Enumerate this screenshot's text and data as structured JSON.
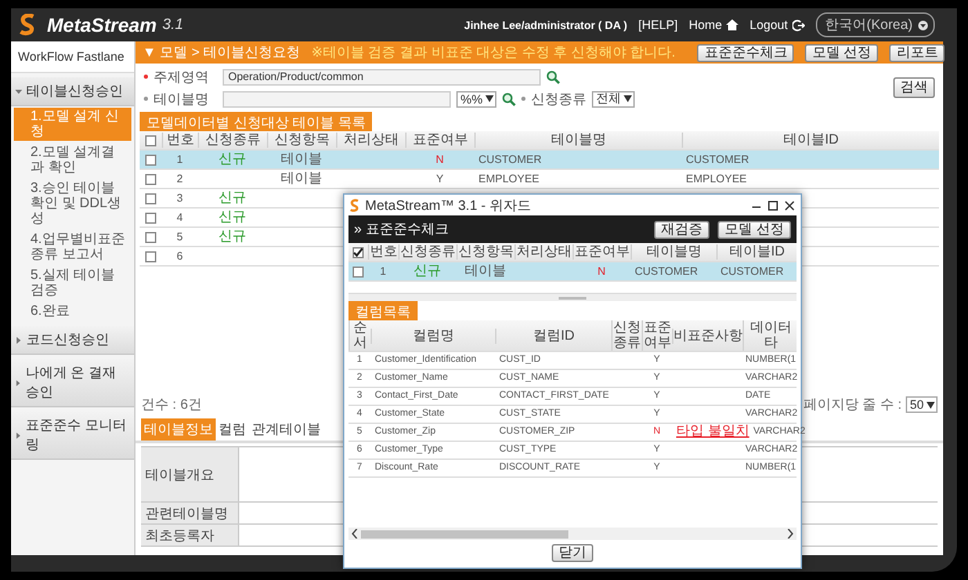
{
  "app": {
    "name": "MetaStream",
    "version": "3.1"
  },
  "header": {
    "user": "Jinhee Lee/administrator ( DA )",
    "help": "[HELP]",
    "home": "Home",
    "logout": "Logout",
    "language": "한국어(Korea)"
  },
  "sidebar": {
    "title": "WorkFlow Fastlane",
    "sections": [
      {
        "label": "테이블신청승인",
        "expanded": true,
        "items": [
          {
            "label": "1.모델 설계 신청",
            "selected": true
          },
          {
            "label": "2.모델 설계결과 확인",
            "selected": false
          },
          {
            "label": "3.승인 테이블 확인 및 DDL생성",
            "selected": false
          },
          {
            "label": "4.업무별비표준 종류 보고서",
            "selected": false
          },
          {
            "label": "5.실제 테이블 검증",
            "selected": false
          },
          {
            "label": "6.완료",
            "selected": false
          }
        ]
      },
      {
        "label": "코드신청승인",
        "expanded": false
      },
      {
        "label": "나에게 온 결재 승인",
        "expanded": false
      },
      {
        "label": "표준준수 모니터링",
        "expanded": false
      }
    ]
  },
  "page": {
    "breadcrumb": "▼ 모델 > 테이블신청요청",
    "notice": "※테이블 검증 결과 비표준 대상은 수정 후 신청해야 합니다.",
    "buttons": [
      "표준준수체크",
      "모델 선정",
      "리포트"
    ]
  },
  "search": {
    "subject_area": {
      "label": "주제영역",
      "value": "Operation/Product/common"
    },
    "table_name": {
      "label": "테이블명",
      "match": "%%"
    },
    "request_type": {
      "label": "신청종류",
      "value": "전체"
    },
    "button": "검색"
  },
  "list": {
    "title": "모델데이터별 신청대상 테이블 목록",
    "all_checked": false,
    "columns": [
      "번호",
      "신청종류",
      "신청항목",
      "처리상태",
      "표준여부",
      "테이블명",
      "테이블ID"
    ],
    "rows": [
      {
        "no": "1",
        "type": "신규",
        "item": "테이블",
        "standard": "N",
        "standard_ok": false,
        "name": "CUSTOMER",
        "id": "CUSTOMER",
        "selected": true,
        "checked": false
      },
      {
        "no": "2",
        "item": "테이블",
        "standard": "Y",
        "standard_ok": true,
        "name": "EMPLOYEE",
        "id": "EMPLOYEE",
        "selected": false,
        "checked": false
      },
      {
        "no": "3",
        "type": "신규",
        "selected": false,
        "checked": false
      },
      {
        "no": "4",
        "type": "신규",
        "selected": false,
        "checked": false
      },
      {
        "no": "5",
        "type": "신규",
        "selected": false,
        "checked": false
      },
      {
        "no": "6",
        "selected": false,
        "checked": false
      }
    ],
    "count": "건수 : 6건",
    "page_size_label": "페이지당 줄 수 :",
    "page_size": "50"
  },
  "detail": {
    "tabs": [
      {
        "label": "테이블정보",
        "selected": true
      },
      {
        "label": "컬럼",
        "selected": false
      },
      {
        "label": "관계테이블",
        "selected": false
      }
    ],
    "fields": [
      "테이블개요",
      "관련테이블명",
      "최초등록자"
    ]
  },
  "dialog": {
    "title": "MetaStream™ 3.1 - 위자드",
    "heading": "» 표준준수체크",
    "buttons": [
      "재검증",
      "모델 선정"
    ],
    "all_checked": true,
    "columns": [
      "번호",
      "신청종류",
      "신청항목",
      "처리상태",
      "표준여부",
      "테이블명",
      "테이블ID"
    ],
    "rows": [
      {
        "no": "1",
        "type": "신규",
        "item": "테이블",
        "standard": "N",
        "standard_ok": false,
        "name": "CUSTOMER",
        "id": "CUSTOMER",
        "selected": true,
        "checked": false
      }
    ],
    "column_list": {
      "title": "컬럼목록",
      "columns": [
        "순서",
        "컬럼명",
        "컬럼ID",
        "신청종류",
        "표준여부",
        "비표준사항",
        "데이터타"
      ],
      "rows": [
        {
          "no": "1",
          "name": "Customer_Identification",
          "id": "CUST_ID",
          "standard": "Y",
          "standard_ok": true,
          "data_type": "NUMBER(1"
        },
        {
          "no": "2",
          "name": "Customer_Name",
          "id": "CUST_NAME",
          "standard": "Y",
          "standard_ok": true,
          "data_type": "VARCHAR2"
        },
        {
          "no": "3",
          "name": "Contact_First_Date",
          "id": "CONTACT_FIRST_DATE",
          "standard": "Y",
          "standard_ok": true,
          "data_type": "DATE"
        },
        {
          "no": "4",
          "name": "Customer_State",
          "id": "CUST_STATE",
          "standard": "Y",
          "standard_ok": true,
          "data_type": "VARCHAR2"
        },
        {
          "no": "5",
          "name": "Customer_Zip",
          "id": "CUSTOMER_ZIP",
          "standard": "N",
          "standard_ok": false,
          "issue": "타입 불일치",
          "data_type": "VARCHAR2"
        },
        {
          "no": "6",
          "name": "Customer_Type",
          "id": "CUST_TYPE",
          "standard": "Y",
          "standard_ok": true,
          "data_type": "VARCHAR2"
        },
        {
          "no": "7",
          "name": "Discount_Rate",
          "id": "DISCOUNT_RATE",
          "standard": "Y",
          "standard_ok": true,
          "data_type": "NUMBER(1"
        }
      ]
    },
    "close": "닫기"
  }
}
